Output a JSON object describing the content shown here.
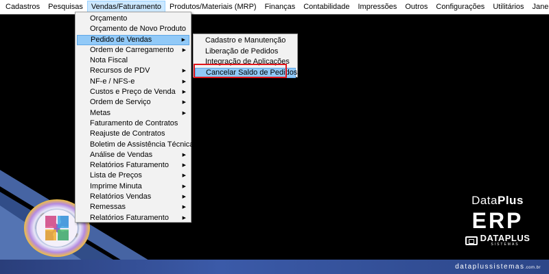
{
  "menubar": {
    "items": [
      "Cadastros",
      "Pesquisas",
      "Vendas/Faturamento",
      "Produtos/Materiais (MRP)",
      "Finanças",
      "Contabilidade",
      "Impressões",
      "Outros",
      "Configurações",
      "Utilitários",
      "Janelas"
    ],
    "active_index": 2
  },
  "vendas_menu": {
    "items": [
      {
        "label": "Orçamento",
        "submenu": false
      },
      {
        "label": "Orçamento de Novo Produto",
        "submenu": false
      },
      {
        "label": "Pedido de Vendas",
        "submenu": true,
        "highlighted": true
      },
      {
        "label": "Ordem de Carregamento",
        "submenu": true
      },
      {
        "label": "Nota Fiscal",
        "submenu": false
      },
      {
        "label": "Recursos de PDV",
        "submenu": true
      },
      {
        "label": "NF-e / NFS-e",
        "submenu": true
      },
      {
        "label": "Custos e Preço de Venda",
        "submenu": true
      },
      {
        "label": "Ordem de Serviço",
        "submenu": true
      },
      {
        "label": "Metas",
        "submenu": true
      },
      {
        "label": "Faturamento de Contratos",
        "submenu": false
      },
      {
        "label": "Reajuste de Contratos",
        "submenu": false
      },
      {
        "label": "Boletim de Assistência Técnica",
        "submenu": false
      },
      {
        "label": "Análise de Vendas",
        "submenu": true
      },
      {
        "label": "Relatórios Faturamento",
        "submenu": true
      },
      {
        "label": "Lista de Preços",
        "submenu": true
      },
      {
        "label": "Imprime Minuta",
        "submenu": true
      },
      {
        "label": "Relatórios Vendas",
        "submenu": true
      },
      {
        "label": "Remessas",
        "submenu": true
      },
      {
        "label": "Relatórios Faturamento",
        "submenu": true
      }
    ]
  },
  "pedido_submenu": {
    "items": [
      {
        "label": "Cadastro e Manutenção"
      },
      {
        "label": "Liberação de Pedidos"
      },
      {
        "label": "Integração de Aplicações"
      },
      {
        "label": "Cancelar Saldo de Pedidos",
        "highlighted": true
      }
    ]
  },
  "brand": {
    "line1_regular": "Data",
    "line1_bold": "Plus",
    "line2": "ERP",
    "logo_text": "DATAPLUS",
    "logo_sub": "SISTEMAS"
  },
  "footer": {
    "url_main": "dataplussistemas",
    "url_suffix": ".com.br"
  },
  "colors": {
    "highlight": "#91c9f7",
    "annotation_box": "#e0151b",
    "bottom_bar": "#3b5aa8"
  }
}
